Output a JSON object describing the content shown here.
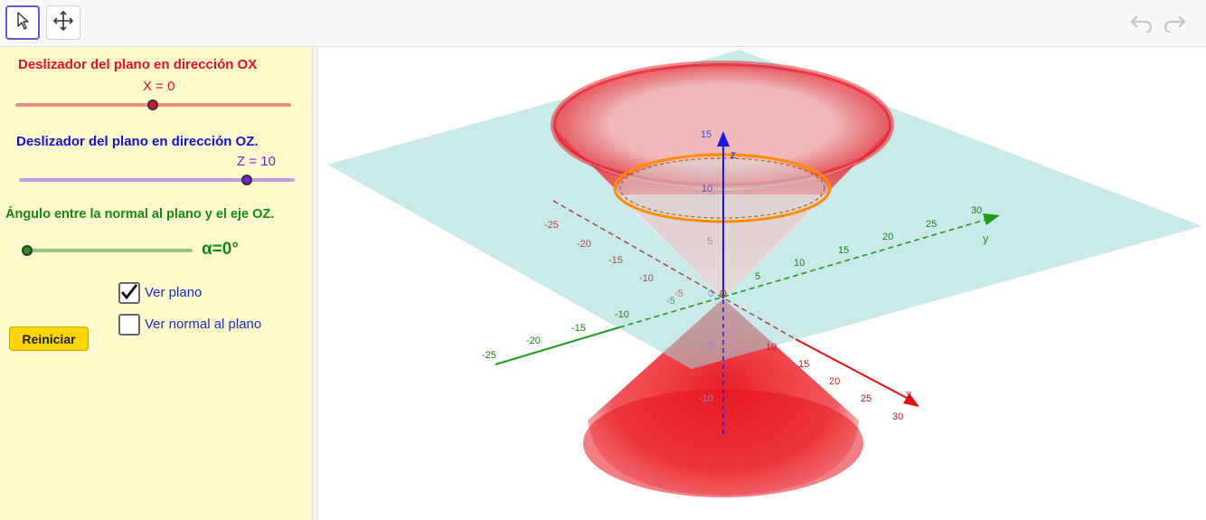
{
  "toolbar": {
    "tools": [
      {
        "name": "move-pointer-tool",
        "icon": "arrow-pointer-icon",
        "active": true
      },
      {
        "name": "move-graphics-view-tool",
        "icon": "four-arrows-icon",
        "active": false
      }
    ],
    "undo_icon": "undo-icon",
    "redo_icon": "redo-icon"
  },
  "panel": {
    "slider_ox": {
      "title": "Deslizador del plano en dirección OX",
      "value_label": "X = 0",
      "color": "#e8101e",
      "track_color": "#ec8f80",
      "knob_color": "#d9162c",
      "value": 0
    },
    "slider_oz": {
      "title": "Deslizador del plano en dirección OZ.",
      "value_label": "Z = 10",
      "color": "#1111d8",
      "track_color": "#c49be0",
      "knob_color": "#7b1fd9",
      "value": 10
    },
    "slider_angle": {
      "title": "Ángulo entre la normal al plano y el eje OZ.",
      "value_label": "α=0°",
      "color": "#138a13",
      "track_color": "#9ac47a",
      "knob_color": "#1e8f1e",
      "value": 0
    },
    "reset_button": "Reiniciar",
    "checkboxes": [
      {
        "label": "Ver plano",
        "checked": true
      },
      {
        "label": "Ver normal al plano",
        "checked": false
      }
    ]
  },
  "graphics": {
    "z_axis": {
      "label": "z",
      "ticks": [
        "15",
        "10",
        "5",
        "0",
        "-5",
        "-10"
      ]
    },
    "y_axis": {
      "label": "y",
      "ticks": [
        "-25",
        "-20",
        "-15",
        "-10",
        "-5",
        "5",
        "10",
        "15",
        "20",
        "25",
        "30"
      ]
    },
    "x_axis": {
      "label": "x",
      "ticks": [
        "-25",
        "-20",
        "-15",
        "-10",
        "-5",
        "5",
        "10",
        "15",
        "20",
        "25",
        "30"
      ]
    },
    "colors": {
      "x_axis": "#e01010",
      "y_axis": "#1a9e1a",
      "z_axis": "#1a1adf",
      "plane": "#9ed8d8",
      "cone": "#e8141e",
      "section": "#ff8c00"
    }
  }
}
